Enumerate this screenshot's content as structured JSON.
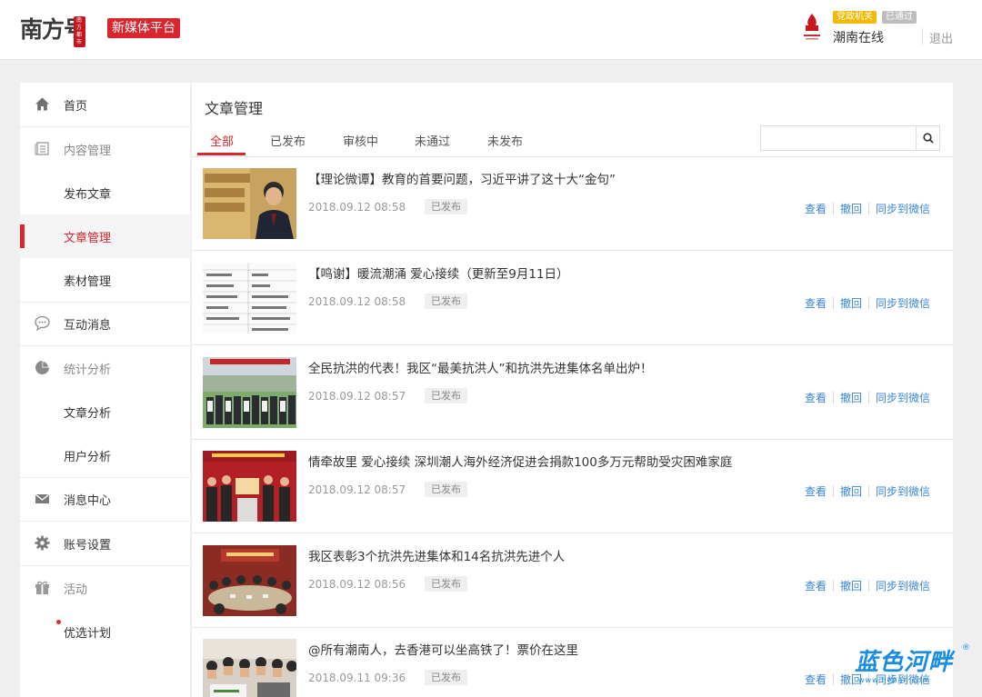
{
  "header": {
    "logo_text": "南方号",
    "logo_mark": "南方都市",
    "platform": "新媒体平台",
    "badge_gov": "党政机关",
    "badge_pass": "已通过",
    "user_name": "潮南在线",
    "logout": "退出"
  },
  "sidebar": {
    "items": [
      {
        "label": "首页",
        "icon": "home-icon"
      },
      {
        "label": "内容管理",
        "icon": "content-icon"
      },
      {
        "label": "发布文章"
      },
      {
        "label": "文章管理"
      },
      {
        "label": "素材管理"
      },
      {
        "label": "互动消息",
        "icon": "chat-icon"
      },
      {
        "label": "统计分析",
        "icon": "pie-chart-icon"
      },
      {
        "label": "文章分析"
      },
      {
        "label": "用户分析"
      },
      {
        "label": "消息中心",
        "icon": "mail-icon"
      },
      {
        "label": "账号设置",
        "icon": "gear-icon"
      },
      {
        "label": "活动",
        "icon": "gift-icon"
      },
      {
        "label": "优选计划"
      }
    ]
  },
  "main": {
    "title": "文章管理",
    "tabs": [
      {
        "label": "全部"
      },
      {
        "label": "已发布"
      },
      {
        "label": "审核中"
      },
      {
        "label": "未通过"
      },
      {
        "label": "未发布"
      }
    ],
    "search": {
      "placeholder": "",
      "value": ""
    },
    "actions": {
      "view": "查看",
      "revoke": "撤回",
      "sync": "同步到微信"
    },
    "articles": [
      {
        "title": "【理论微谭】教育的首要问题，习近平讲了这十大“金句”",
        "date": "2018.09.12 08:58",
        "status": "已发布"
      },
      {
        "title": "【鸣谢】暖流潮涌 爱心接续（更新至9月11日）",
        "date": "2018.09.12 08:58",
        "status": "已发布"
      },
      {
        "title": "全民抗洪的代表！我区“最美抗洪人”和抗洪先进集体名单出炉！",
        "date": "2018.09.12 08:57",
        "status": "已发布"
      },
      {
        "title": "情牵故里 爱心接续 深圳潮人海外经济促进会捐款100多万元帮助受灾困难家庭",
        "date": "2018.09.12 08:57",
        "status": "已发布"
      },
      {
        "title": "我区表彰3个抗洪先进集体和14名抗洪先进个人",
        "date": "2018.09.12 08:56",
        "status": "已发布"
      },
      {
        "title": "@所有潮南人，去香港可以坐高铁了！票价在这里",
        "date": "2018.09.11 09:36",
        "status": "已发布"
      }
    ]
  },
  "watermark": {
    "text": "蓝色河畔",
    "url": "www.hepan.com",
    "reg": "®"
  },
  "colors": {
    "accent": "#d7262c",
    "link": "#3a86d3"
  }
}
